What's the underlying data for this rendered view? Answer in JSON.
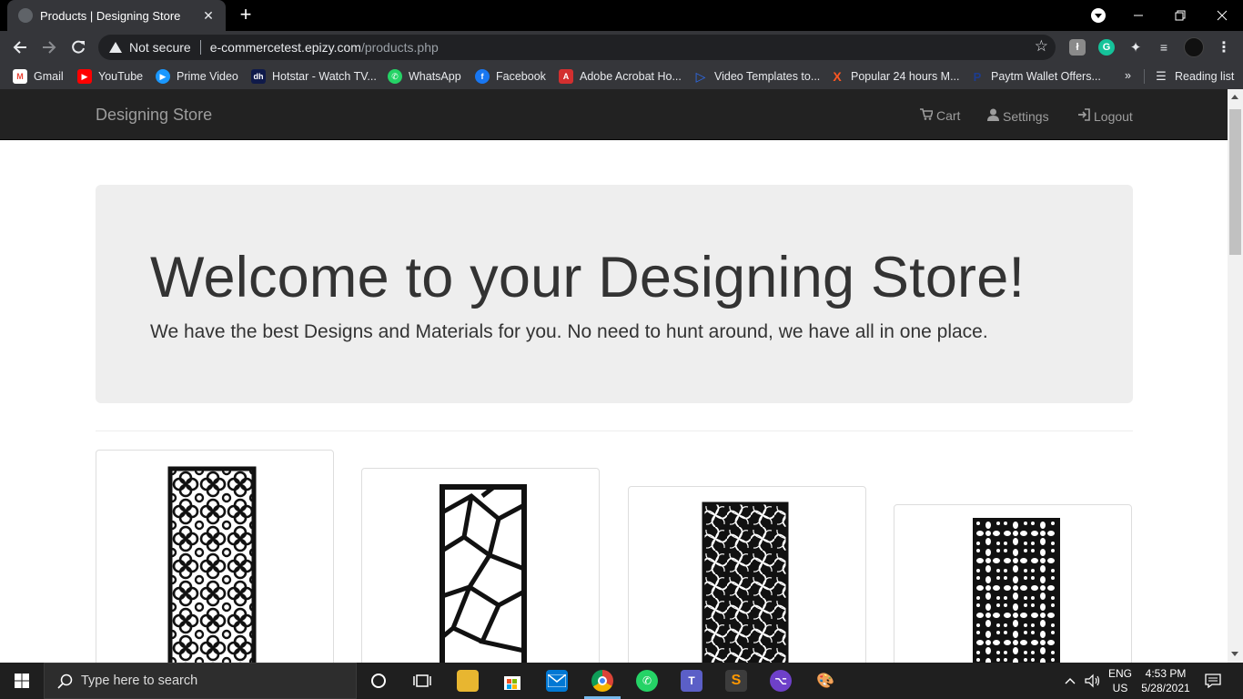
{
  "browser": {
    "tab_title": "Products | Designing Store",
    "tab_close": "✕",
    "new_tab": "+",
    "security_label": "Not secure",
    "url_host": "e-commercetest.epizy.com",
    "url_path": "/products.php",
    "bookmarks": [
      {
        "label": "Gmail",
        "icon": "gmail-icon",
        "color": "#ea4335",
        "glyph": "M"
      },
      {
        "label": "YouTube",
        "icon": "youtube-icon",
        "color": "#ff0000",
        "glyph": "▶"
      },
      {
        "label": "Prime Video",
        "icon": "prime-video-icon",
        "color": "#1a98ff",
        "glyph": "▶"
      },
      {
        "label": "Hotstar - Watch TV...",
        "icon": "hotstar-icon",
        "color": "#0f1a4a",
        "glyph": "dh"
      },
      {
        "label": "WhatsApp",
        "icon": "whatsapp-icon",
        "color": "#25d366",
        "glyph": "✆"
      },
      {
        "label": "Facebook",
        "icon": "facebook-icon",
        "color": "#1877f2",
        "glyph": "f"
      },
      {
        "label": "Adobe Acrobat Ho...",
        "icon": "adobe-acrobat-icon",
        "color": "#d32f2f",
        "glyph": "A"
      },
      {
        "label": "Video Templates to...",
        "icon": "video-templates-icon",
        "color": "#2d6ef5",
        "glyph": "▷"
      },
      {
        "label": "Popular 24 hours M...",
        "icon": "popular-x-icon",
        "color": "#ff5722",
        "glyph": "X"
      },
      {
        "label": "Paytm Wallet Offers...",
        "icon": "paytm-icon",
        "color": "#0b2a6f",
        "glyph": "P"
      }
    ],
    "bookmarks_overflow": "»",
    "reading_list": "Reading list"
  },
  "site": {
    "brand": "Designing Store",
    "nav": {
      "cart": "Cart",
      "settings": "Settings",
      "logout": "Logout"
    },
    "jumbotron": {
      "heading": "Welcome to your Designing Store!",
      "text": "We have the best Designs and Materials for you. No need to hunt around, we have all in one place."
    },
    "products": [
      {
        "name": "quatrefoil-panel",
        "pattern": "quatrefoil"
      },
      {
        "name": "shattered-glass-panel",
        "pattern": "shattered"
      },
      {
        "name": "spiral-fan-panel",
        "pattern": "spiral"
      },
      {
        "name": "floral-lattice-panel",
        "pattern": "floral"
      }
    ]
  },
  "taskbar": {
    "search_placeholder": "Type here to search",
    "language_top": "ENG",
    "language_bottom": "US",
    "time": "4:53 PM",
    "date": "5/28/2021"
  }
}
